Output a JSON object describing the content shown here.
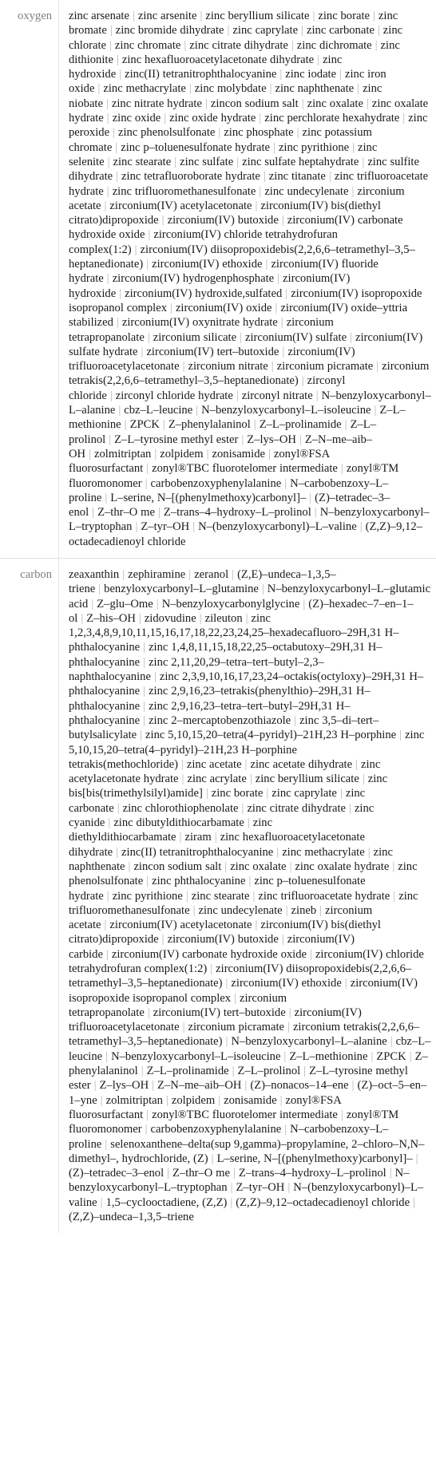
{
  "table": {
    "separator": "|",
    "rows": [
      {
        "label": "oxygen",
        "items": [
          "zinc arsenate",
          "zinc arsenite",
          "zinc beryllium silicate",
          "zinc borate",
          "zinc bromate",
          "zinc bromide dihydrate",
          "zinc caprylate",
          "zinc carbonate",
          "zinc chlorate",
          "zinc chromate",
          "zinc citrate dihydrate",
          "zinc dichromate",
          "zinc dithionite",
          "zinc hexafluoroacetylacetonate dihydrate",
          "zinc hydroxide",
          "zinc(II) tetranitrophthalocyanine",
          "zinc iodate",
          "zinc iron oxide",
          "zinc methacrylate",
          "zinc molybdate",
          "zinc naphthenate",
          "zinc niobate",
          "zinc nitrate hydrate",
          "zincon sodium salt",
          "zinc oxalate",
          "zinc oxalate hydrate",
          "zinc oxide",
          "zinc oxide hydrate",
          "zinc perchlorate hexahydrate",
          "zinc peroxide",
          "zinc phenolsulfonate",
          "zinc phosphate",
          "zinc potassium chromate",
          "zinc p–toluenesulfonate hydrate",
          "zinc pyrithione",
          "zinc selenite",
          "zinc stearate",
          "zinc sulfate",
          "zinc sulfate heptahydrate",
          "zinc sulfite dihydrate",
          "zinc tetrafluoroborate hydrate",
          "zinc titanate",
          "zinc trifluoroacetate hydrate",
          "zinc trifluoromethanesulfonate",
          "zinc undecylenate",
          "zirconium acetate",
          "zirconium(IV) acetylacetonate",
          "zirconium(IV) bis(diethyl citrato)dipropoxide",
          "zirconium(IV) butoxide",
          "zirconium(IV) carbonate hydroxide oxide",
          "zirconium(IV) chloride tetrahydrofuran complex(1:2)",
          "zirconium(IV) diisopropoxidebis(2,2,6,6–tetramethyl–3,5–heptanedionate)",
          "zirconium(IV) ethoxide",
          "zirconium(IV) fluoride hydrate",
          "zirconium(IV) hydrogenphosphate",
          "zirconium(IV) hydroxide",
          "zirconium(IV) hydroxide,sulfated",
          "zirconium(IV) isopropoxide isopropanol complex",
          "zirconium(IV) oxide",
          "zirconium(IV) oxide–yttria stabilized",
          "zirconium(IV) oxynitrate hydrate",
          "zirconium tetrapropanolate",
          "zirconium silicate",
          "zirconium(IV) sulfate",
          "zirconium(IV) sulfate hydrate",
          "zirconium(IV) tert–butoxide",
          "zirconium(IV) trifluoroacetylacetonate",
          "zirconium nitrate",
          "zirconium picramate",
          "zirconium tetrakis(2,2,6,6–tetramethyl–3,5–heptanedionate)",
          "zirconyl chloride",
          "zirconyl chloride hydrate",
          "zirconyl nitrate",
          "N–benzyloxycarbonyl–L–alanine",
          "cbz–L–leucine",
          "N–benzyloxycarbonyl–L–isoleucine",
          "Z–L–methionine",
          "ZPCK",
          "Z–phenylalaninol",
          "Z–L–prolinamide",
          "Z–L–prolinol",
          "Z–L–tyrosine methyl ester",
          "Z–lys–OH",
          "Z–N–me–aib–OH",
          "zolmitriptan",
          "zolpidem",
          "zonisamide",
          "zonyl®FSA fluorosurfactant",
          "zonyl®TBC fluorotelomer intermediate",
          "zonyl®TM fluoromonomer",
          "carbobenzoxyphenylalanine",
          "N–carbobenzoxy–L–proline",
          "L–serine, N–[(phenylmethoxy)carbonyl]–",
          "(Z)–tetradec–3–enol",
          "Z–thr–O me",
          "Z–trans–4–hydroxy–L–prolinol",
          "N–benzyloxycarbonyl–L–tryptophan",
          "Z–tyr–OH",
          "N–(benzyloxycarbonyl)–L–valine",
          "(Z,Z)–9,12–octadecadienoyl chloride"
        ]
      },
      {
        "label": "carbon",
        "items": [
          "zeaxanthin",
          "zephiramine",
          "zeranol",
          "(Z,E)–undeca–1,3,5–triene",
          "benzyloxycarbonyl–L–glutamine",
          "N–benzyloxycarbonyl–L–glutamic acid",
          "Z–glu–Ome",
          "N–benzyloxycarbonylglycine",
          "(Z)–hexadec–7–en–1–ol",
          "Z–his–OH",
          "zidovudine",
          "zileuton",
          "zinc 1,2,3,4,8,9,10,11,15,16,17,18,22,23,24,25–hexadecafluoro–29H,31 H–phthalocyanine",
          "zinc 1,4,8,11,15,18,22,25–octabutoxy–29H,31 H–phthalocyanine",
          "zinc 2,11,20,29–tetra–tert–butyl–2,3–naphthalocyanine",
          "zinc 2,3,9,10,16,17,23,24–octakis(octyloxy)–29H,31 H–phthalocyanine",
          "zinc 2,9,16,23–tetrakis(phenylthio)–29H,31 H–phthalocyanine",
          "zinc 2,9,16,23–tetra–tert–butyl–29H,31 H–phthalocyanine",
          "zinc 2–mercaptobenzothiazole",
          "zinc 3,5–di–tert–butylsalicylate",
          "zinc 5,10,15,20–tetra(4–pyridyl)–21H,23 H–porphine",
          "zinc 5,10,15,20–tetra(4–pyridyl)–21H,23 H–porphine tetrakis(methochloride)",
          "zinc acetate",
          "zinc acetate dihydrate",
          "zinc acetylacetonate hydrate",
          "zinc acrylate",
          "zinc beryllium silicate",
          "zinc bis[bis(trimethylsilyl)amide]",
          "zinc borate",
          "zinc caprylate",
          "zinc carbonate",
          "zinc chlorothiophenolate",
          "zinc citrate dihydrate",
          "zinc cyanide",
          "zinc dibutyldithiocarbamate",
          "zinc diethyldithiocarbamate",
          "ziram",
          "zinc hexafluoroacetylacetonate dihydrate",
          "zinc(II) tetranitrophthalocyanine",
          "zinc methacrylate",
          "zinc naphthenate",
          "zincon sodium salt",
          "zinc oxalate",
          "zinc oxalate hydrate",
          "zinc phenolsulfonate",
          "zinc phthalocyanine",
          "zinc p–toluenesulfonate hydrate",
          "zinc pyrithione",
          "zinc stearate",
          "zinc trifluoroacetate hydrate",
          "zinc trifluoromethanesulfonate",
          "zinc undecylenate",
          "zineb",
          "zirconium acetate",
          "zirconium(IV) acetylacetonate",
          "zirconium(IV) bis(diethyl citrato)dipropoxide",
          "zirconium(IV) butoxide",
          "zirconium(IV) carbide",
          "zirconium(IV) carbonate hydroxide oxide",
          "zirconium(IV) chloride tetrahydrofuran complex(1:2)",
          "zirconium(IV) diisopropoxidebis(2,2,6,6–tetramethyl–3,5–heptanedionate)",
          "zirconium(IV) ethoxide",
          "zirconium(IV) isopropoxide isopropanol complex",
          "zirconium tetrapropanolate",
          "zirconium(IV) tert–butoxide",
          "zirconium(IV) trifluoroacetylacetonate",
          "zirconium picramate",
          "zirconium tetrakis(2,2,6,6–tetramethyl–3,5–heptanedionate)",
          "N–benzyloxycarbonyl–L–alanine",
          "cbz–L–leucine",
          "N–benzyloxycarbonyl–L–isoleucine",
          "Z–L–methionine",
          "ZPCK",
          "Z–phenylalaninol",
          "Z–L–prolinamide",
          "Z–L–prolinol",
          "Z–L–tyrosine methyl ester",
          "Z–lys–OH",
          "Z–N–me–aib–OH",
          "(Z)–nonacos–14–ene",
          "(Z)–oct–5–en–1–yne",
          "zolmitriptan",
          "zolpidem",
          "zonisamide",
          "zonyl®FSA fluorosurfactant",
          "zonyl®TBC fluorotelomer intermediate",
          "zonyl®TM fluoromonomer",
          "carbobenzoxyphenylalanine",
          "N–carbobenzoxy–L–proline",
          "selenoxanthene–delta(sup 9,gamma)–propylamine, 2–chloro–N,N–dimethyl–, hydrochloride, (Z)",
          "L–serine, N–[(phenylmethoxy)carbonyl]–",
          "(Z)–tetradec–3–enol",
          "Z–thr–O me",
          "Z–trans–4–hydroxy–L–prolinol",
          "N–benzyloxycarbonyl–L–tryptophan",
          "Z–tyr–OH",
          "N–(benzyloxycarbonyl)–L–valine",
          "1,5–cyclooctadiene, (Z,Z)",
          "(Z,Z)–9,12–octadecadienoyl chloride",
          "(Z,Z)–undeca–1,3,5–triene"
        ]
      }
    ]
  },
  "colors": {
    "label_text": "#808080",
    "content_text": "#1a1a1a",
    "separator": "#b4b4b4",
    "border": "#e2e2e2",
    "background": "#ffffff"
  }
}
